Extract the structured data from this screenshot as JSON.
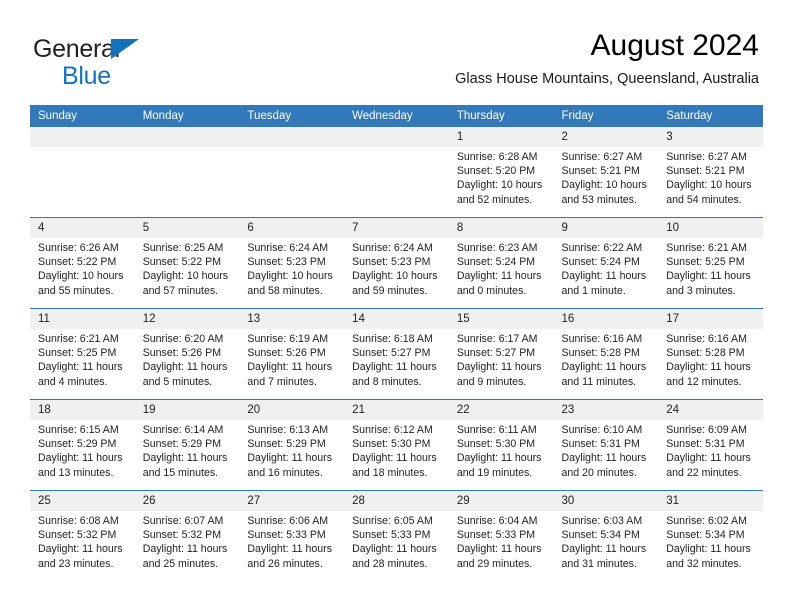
{
  "brand": {
    "line1": "General",
    "line2": "Blue",
    "triangle_color": "#1273bd",
    "text_color": "#231f20"
  },
  "header": {
    "title": "August 2024",
    "subtitle": "Glass House Mountains, Queensland, Australia"
  },
  "theme": {
    "header_blue": "#3179ba",
    "date_band": "#f0f0f0",
    "text": "#232323"
  },
  "calendar": {
    "weekday_headers": [
      "Sunday",
      "Monday",
      "Tuesday",
      "Wednesday",
      "Thursday",
      "Friday",
      "Saturday"
    ],
    "weeks": [
      [
        {
          "day": "",
          "lines": []
        },
        {
          "day": "",
          "lines": []
        },
        {
          "day": "",
          "lines": []
        },
        {
          "day": "",
          "lines": []
        },
        {
          "day": "1",
          "lines": [
            "Sunrise: 6:28 AM",
            "Sunset: 5:20 PM",
            "Daylight: 10 hours",
            "and 52 minutes."
          ]
        },
        {
          "day": "2",
          "lines": [
            "Sunrise: 6:27 AM",
            "Sunset: 5:21 PM",
            "Daylight: 10 hours",
            "and 53 minutes."
          ]
        },
        {
          "day": "3",
          "lines": [
            "Sunrise: 6:27 AM",
            "Sunset: 5:21 PM",
            "Daylight: 10 hours",
            "and 54 minutes."
          ]
        }
      ],
      [
        {
          "day": "4",
          "lines": [
            "Sunrise: 6:26 AM",
            "Sunset: 5:22 PM",
            "Daylight: 10 hours",
            "and 55 minutes."
          ]
        },
        {
          "day": "5",
          "lines": [
            "Sunrise: 6:25 AM",
            "Sunset: 5:22 PM",
            "Daylight: 10 hours",
            "and 57 minutes."
          ]
        },
        {
          "day": "6",
          "lines": [
            "Sunrise: 6:24 AM",
            "Sunset: 5:23 PM",
            "Daylight: 10 hours",
            "and 58 minutes."
          ]
        },
        {
          "day": "7",
          "lines": [
            "Sunrise: 6:24 AM",
            "Sunset: 5:23 PM",
            "Daylight: 10 hours",
            "and 59 minutes."
          ]
        },
        {
          "day": "8",
          "lines": [
            "Sunrise: 6:23 AM",
            "Sunset: 5:24 PM",
            "Daylight: 11 hours",
            "and 0 minutes."
          ]
        },
        {
          "day": "9",
          "lines": [
            "Sunrise: 6:22 AM",
            "Sunset: 5:24 PM",
            "Daylight: 11 hours",
            "and 1 minute."
          ]
        },
        {
          "day": "10",
          "lines": [
            "Sunrise: 6:21 AM",
            "Sunset: 5:25 PM",
            "Daylight: 11 hours",
            "and 3 minutes."
          ]
        }
      ],
      [
        {
          "day": "11",
          "lines": [
            "Sunrise: 6:21 AM",
            "Sunset: 5:25 PM",
            "Daylight: 11 hours",
            "and 4 minutes."
          ]
        },
        {
          "day": "12",
          "lines": [
            "Sunrise: 6:20 AM",
            "Sunset: 5:26 PM",
            "Daylight: 11 hours",
            "and 5 minutes."
          ]
        },
        {
          "day": "13",
          "lines": [
            "Sunrise: 6:19 AM",
            "Sunset: 5:26 PM",
            "Daylight: 11 hours",
            "and 7 minutes."
          ]
        },
        {
          "day": "14",
          "lines": [
            "Sunrise: 6:18 AM",
            "Sunset: 5:27 PM",
            "Daylight: 11 hours",
            "and 8 minutes."
          ]
        },
        {
          "day": "15",
          "lines": [
            "Sunrise: 6:17 AM",
            "Sunset: 5:27 PM",
            "Daylight: 11 hours",
            "and 9 minutes."
          ]
        },
        {
          "day": "16",
          "lines": [
            "Sunrise: 6:16 AM",
            "Sunset: 5:28 PM",
            "Daylight: 11 hours",
            "and 11 minutes."
          ]
        },
        {
          "day": "17",
          "lines": [
            "Sunrise: 6:16 AM",
            "Sunset: 5:28 PM",
            "Daylight: 11 hours",
            "and 12 minutes."
          ]
        }
      ],
      [
        {
          "day": "18",
          "lines": [
            "Sunrise: 6:15 AM",
            "Sunset: 5:29 PM",
            "Daylight: 11 hours",
            "and 13 minutes."
          ]
        },
        {
          "day": "19",
          "lines": [
            "Sunrise: 6:14 AM",
            "Sunset: 5:29 PM",
            "Daylight: 11 hours",
            "and 15 minutes."
          ]
        },
        {
          "day": "20",
          "lines": [
            "Sunrise: 6:13 AM",
            "Sunset: 5:29 PM",
            "Daylight: 11 hours",
            "and 16 minutes."
          ]
        },
        {
          "day": "21",
          "lines": [
            "Sunrise: 6:12 AM",
            "Sunset: 5:30 PM",
            "Daylight: 11 hours",
            "and 18 minutes."
          ]
        },
        {
          "day": "22",
          "lines": [
            "Sunrise: 6:11 AM",
            "Sunset: 5:30 PM",
            "Daylight: 11 hours",
            "and 19 minutes."
          ]
        },
        {
          "day": "23",
          "lines": [
            "Sunrise: 6:10 AM",
            "Sunset: 5:31 PM",
            "Daylight: 11 hours",
            "and 20 minutes."
          ]
        },
        {
          "day": "24",
          "lines": [
            "Sunrise: 6:09 AM",
            "Sunset: 5:31 PM",
            "Daylight: 11 hours",
            "and 22 minutes."
          ]
        }
      ],
      [
        {
          "day": "25",
          "lines": [
            "Sunrise: 6:08 AM",
            "Sunset: 5:32 PM",
            "Daylight: 11 hours",
            "and 23 minutes."
          ]
        },
        {
          "day": "26",
          "lines": [
            "Sunrise: 6:07 AM",
            "Sunset: 5:32 PM",
            "Daylight: 11 hours",
            "and 25 minutes."
          ]
        },
        {
          "day": "27",
          "lines": [
            "Sunrise: 6:06 AM",
            "Sunset: 5:33 PM",
            "Daylight: 11 hours",
            "and 26 minutes."
          ]
        },
        {
          "day": "28",
          "lines": [
            "Sunrise: 6:05 AM",
            "Sunset: 5:33 PM",
            "Daylight: 11 hours",
            "and 28 minutes."
          ]
        },
        {
          "day": "29",
          "lines": [
            "Sunrise: 6:04 AM",
            "Sunset: 5:33 PM",
            "Daylight: 11 hours",
            "and 29 minutes."
          ]
        },
        {
          "day": "30",
          "lines": [
            "Sunrise: 6:03 AM",
            "Sunset: 5:34 PM",
            "Daylight: 11 hours",
            "and 31 minutes."
          ]
        },
        {
          "day": "31",
          "lines": [
            "Sunrise: 6:02 AM",
            "Sunset: 5:34 PM",
            "Daylight: 11 hours",
            "and 32 minutes."
          ]
        }
      ]
    ]
  }
}
